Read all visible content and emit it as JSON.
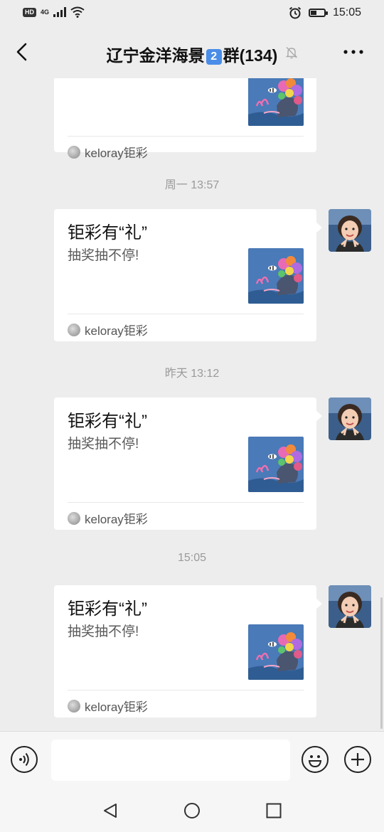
{
  "status_bar": {
    "network_badge": "HD",
    "network_type": "4G",
    "time": "15:05",
    "battery_level_percent": 45,
    "icons": [
      "hd-icon",
      "signal-icon",
      "wifi-icon",
      "alarm-icon",
      "battery-icon"
    ]
  },
  "header": {
    "title_prefix": "辽宁金洋海景",
    "title_badge": "2",
    "title_suffix": "群(134)",
    "icons": [
      "back-arrow-icon",
      "mute-bell-icon",
      "more-dots-icon"
    ]
  },
  "messages": [
    {
      "timestamp": "",
      "title": "",
      "description": "",
      "source": "keloray钜彩",
      "partial": true
    },
    {
      "timestamp": "周一 13:57",
      "title": "钜彩有“礼”",
      "description": "抽奖抽不停!",
      "source": "keloray钜彩"
    },
    {
      "timestamp": "昨天 13:12",
      "title": "钜彩有“礼”",
      "description": "抽奖抽不停!",
      "source": "keloray钜彩"
    },
    {
      "timestamp": "15:05",
      "title": "钜彩有“礼”",
      "description": "抽奖抽不停!",
      "source": "keloray钜彩"
    }
  ],
  "input_bar": {
    "placeholder": "",
    "icons": [
      "voice-icon",
      "emoji-icon",
      "plus-icon"
    ]
  },
  "system_nav": {
    "icons": [
      "nav-back-icon",
      "nav-home-icon",
      "nav-recents-icon"
    ]
  },
  "colors": {
    "background": "#ededed",
    "card": "#ffffff",
    "thumb_bg": "#4a7ab8",
    "badge_blue": "#4a8de8"
  }
}
